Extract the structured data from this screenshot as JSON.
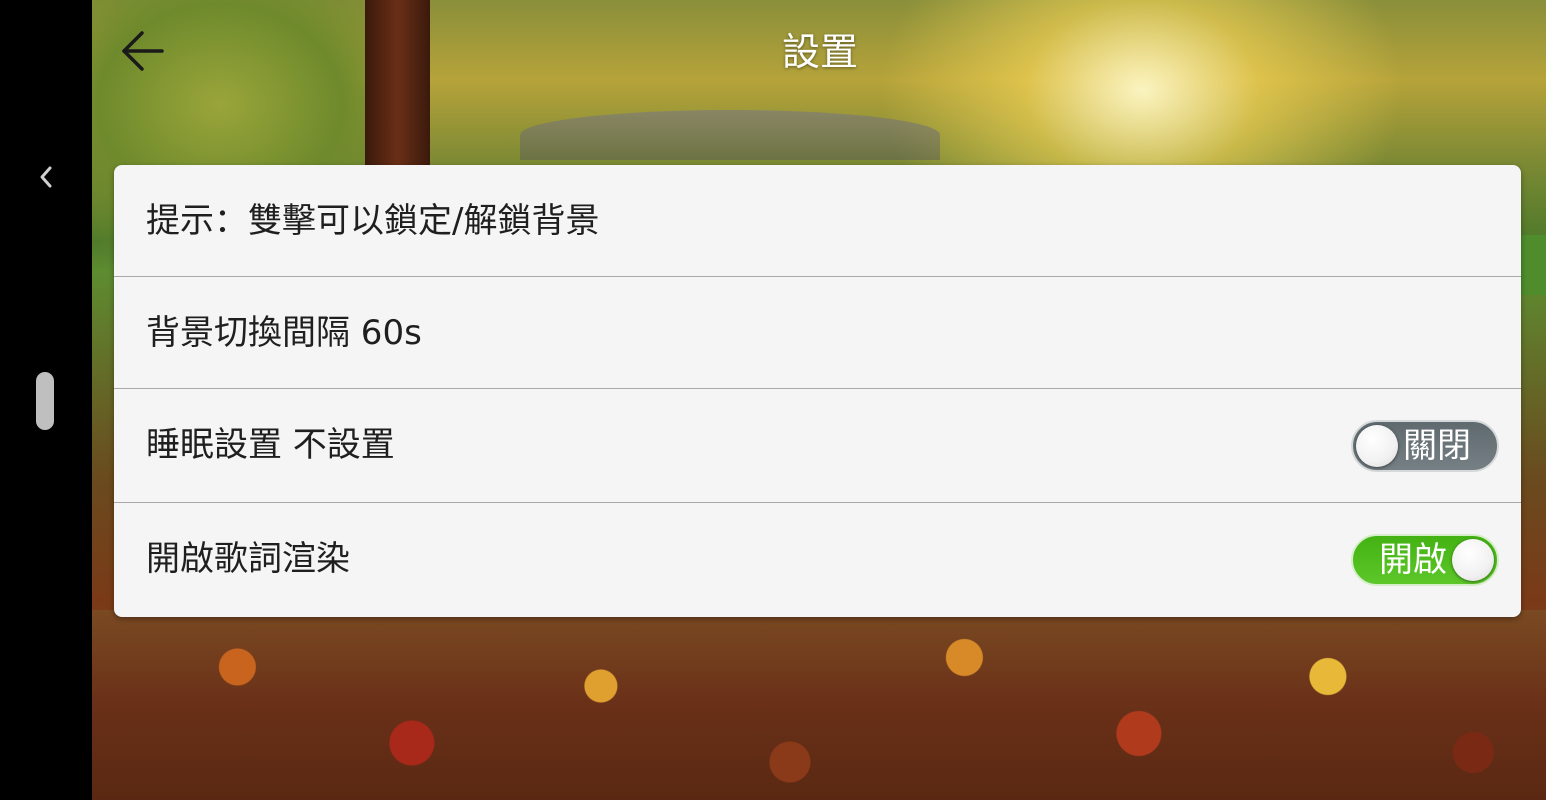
{
  "header": {
    "title": "設置",
    "back_icon": "arrow-left-icon"
  },
  "system": {
    "side_chevron_icon": "chevron-left-icon"
  },
  "settings": {
    "rows": [
      {
        "label": "提示：雙擊可以鎖定/解鎖背景"
      },
      {
        "label": "背景切換間隔 60s"
      },
      {
        "label": "睡眠設置 不設置",
        "toggle": {
          "text": "關閉",
          "state": "off"
        }
      },
      {
        "label": "開啟歌詞渲染",
        "toggle": {
          "text": "開啟",
          "state": "on"
        }
      }
    ]
  },
  "colors": {
    "toggle_on": "#4cb81a",
    "toggle_off": "#6a7479",
    "card_bg": "#f5f5f5"
  }
}
